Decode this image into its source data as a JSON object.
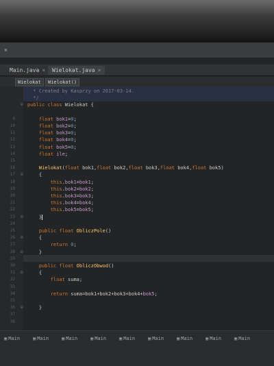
{
  "tabs": [
    {
      "label": "Main.java",
      "active": false
    },
    {
      "label": "Wielokat.java",
      "active": true
    }
  ],
  "breadcrumbs": [
    "Wielokat",
    "Wielokat()"
  ],
  "code": [
    {
      "n": "",
      "text": "  * Created by Kasprzy on 2017-03-14."
    },
    {
      "n": "",
      "text": "  */"
    },
    {
      "n": "",
      "text": "public class Wielokat {"
    },
    {
      "n": "",
      "text": ""
    },
    {
      "n": "9",
      "text": "    float bok1=0;"
    },
    {
      "n": "10",
      "text": "    float bok2=0;"
    },
    {
      "n": "11",
      "text": "    float bok3=0;"
    },
    {
      "n": "12",
      "text": "    float bok4=0;"
    },
    {
      "n": "13",
      "text": "    float bok5=0;"
    },
    {
      "n": "14",
      "text": "    float ile;"
    },
    {
      "n": "15",
      "text": ""
    },
    {
      "n": "16",
      "text": "    Wielokat(float bok1,float bok2,float bok3,float bok4,float bok5)"
    },
    {
      "n": "17",
      "text": "    {"
    },
    {
      "n": "18",
      "text": "        this.bok1=bok1;"
    },
    {
      "n": "19",
      "text": "        this.bok2=bok2;"
    },
    {
      "n": "20",
      "text": "        this.bok3=bok3;"
    },
    {
      "n": "21",
      "text": "        this.bok4=bok4;"
    },
    {
      "n": "22",
      "text": "        this.bok5=bok5;"
    },
    {
      "n": "23",
      "text": "    }"
    },
    {
      "n": "24",
      "text": ""
    },
    {
      "n": "25",
      "text": "    public float ObliczPole()"
    },
    {
      "n": "26",
      "text": "    {"
    },
    {
      "n": "27",
      "text": "        return 0;"
    },
    {
      "n": "28",
      "text": "    }"
    },
    {
      "n": "29",
      "text": ""
    },
    {
      "n": "30",
      "text": "    public float ObliczObwod()"
    },
    {
      "n": "31",
      "text": "    {"
    },
    {
      "n": "32",
      "text": "        float suma;"
    },
    {
      "n": "33",
      "text": ""
    },
    {
      "n": "34",
      "text": "        return suma=bok1+bok2+bok3+bok4+bok5;"
    },
    {
      "n": "35",
      "text": ""
    },
    {
      "n": "36",
      "text": "    }"
    },
    {
      "n": "37",
      "text": ""
    },
    {
      "n": "38",
      "text": ""
    }
  ],
  "bottom_tabs": [
    "Main",
    "Main",
    "Main",
    "Main",
    "Main",
    "Main",
    "Main",
    "Main",
    "Main"
  ]
}
